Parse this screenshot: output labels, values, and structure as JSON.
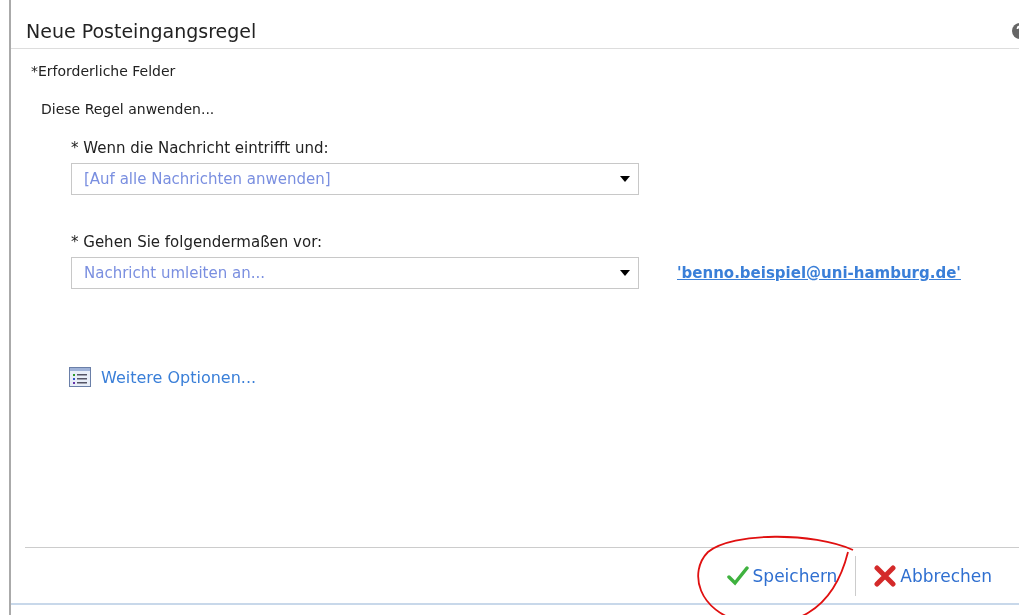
{
  "dialog": {
    "title": "Neue Posteingangsregel",
    "required_note": "*Erforderliche Felder",
    "intro": "Diese Regel anwenden..."
  },
  "conditions": [
    {
      "label": "* Wenn die Nachricht eintrifft und:",
      "value": "[Auf alle Nachrichten anwenden]"
    },
    {
      "label": "* Gehen Sie folgendermaßen vor:",
      "value": "Nachricht umleiten an...",
      "link": "'benno.beispiel@uni-hamburg.de'"
    }
  ],
  "more_options": "Weitere Optionen...",
  "buttons": [
    {
      "kind": "save",
      "label": "Speichern",
      "annotated": true
    },
    {
      "kind": "cancel",
      "label": "Abbrechen",
      "annotated": false
    }
  ]
}
